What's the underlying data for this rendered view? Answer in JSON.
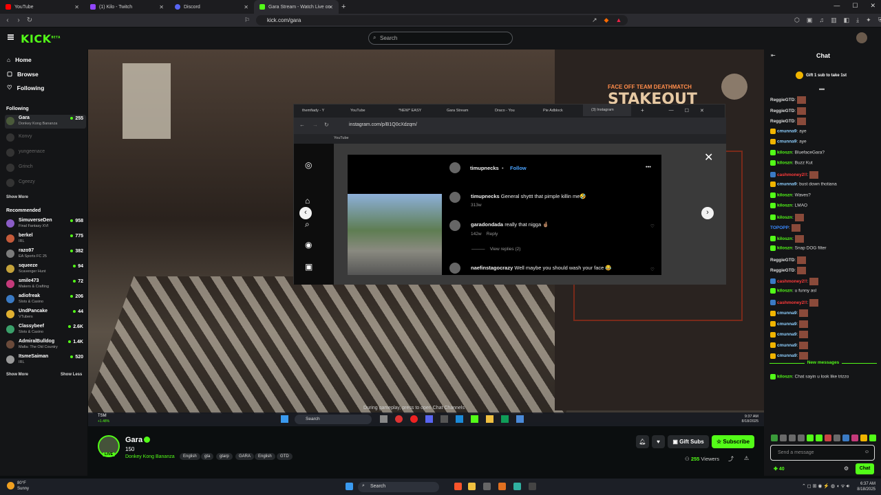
{
  "browser": {
    "tabs": [
      {
        "title": "YouTube",
        "color": "#ff0000"
      },
      {
        "title": "(1) Kilo - Twitch",
        "color": "#9146ff"
      },
      {
        "title": "Discord",
        "color": "#5865f2"
      },
      {
        "title": "Gara Stream - Watch Live on",
        "color": "#53fc18"
      }
    ],
    "url": "kick.com/gara"
  },
  "header": {
    "logo": "KICK",
    "logo_sup": "BETA",
    "search_placeholder": "Search"
  },
  "sidebar": {
    "nav": [
      {
        "label": "Home",
        "icon": "home-icon"
      },
      {
        "label": "Browse",
        "icon": "browse-icon"
      },
      {
        "label": "Following",
        "icon": "heart-icon"
      }
    ],
    "following_heading": "Following",
    "following": [
      {
        "name": "Gara",
        "game": "Donkey Kong Bananza",
        "viewers": "255",
        "live": true
      },
      {
        "name": "Konvy",
        "live": false
      },
      {
        "name": "yungeenace",
        "live": false
      },
      {
        "name": "Grinch",
        "live": false
      },
      {
        "name": "Cgeezy",
        "live": false
      }
    ],
    "show_more_1": "Show More",
    "recommended_heading": "Recommended",
    "recommended": [
      {
        "name": "SimuverseDen",
        "game": "Final Fantasy XVI",
        "viewers": "958",
        "color": "#8a5cc6"
      },
      {
        "name": "berkel",
        "game": "IRL",
        "viewers": "775",
        "color": "#c45a3a"
      },
      {
        "name": "razo97",
        "game": "EA Sports FC 25",
        "viewers": "382",
        "color": "#7b7b7b"
      },
      {
        "name": "squeeze",
        "game": "Scavenger Hunt",
        "viewers": "94",
        "color": "#c4a23a"
      },
      {
        "name": "smile473",
        "game": "Makers & Crafting",
        "viewers": "72",
        "color": "#c43a7a"
      },
      {
        "name": "adiofreak",
        "game": "Slots & Casino",
        "viewers": "206",
        "color": "#3a7ac4"
      },
      {
        "name": "UndPancake",
        "game": "VTubers",
        "viewers": "44",
        "color": "#e0b030"
      },
      {
        "name": "Classybeef",
        "game": "Slots & Casino",
        "viewers": "2.6K",
        "color": "#3aa06a"
      },
      {
        "name": "AdmiralBulldog",
        "game": "Mafia: The Old Country",
        "viewers": "1.4K",
        "color": "#6a4a3a"
      },
      {
        "name": "ItsmeSaiman",
        "game": "IRL",
        "viewers": "520",
        "color": "#999999"
      }
    ],
    "show_more_2": "Show More",
    "show_less": "Show Less"
  },
  "video": {
    "stakeout_small": "FACE OFF TEAM DEATHMATCH",
    "stakeout": "STAKEOUT",
    "caption": "During gameplay, press     to open Chat Channels",
    "inner_taskbar": {
      "search": "Search",
      "ticker": "TSM",
      "ticker_change": "+1.48%",
      "time": "9:37 AM",
      "date": "8/18/2025"
    },
    "instagram_window": {
      "tabs": [
        "themfiady - Y",
        "YouTube",
        "*NEW* EASY",
        "Gara Stream",
        "Draco - You",
        "Pie Adblock",
        "(3) Instagram"
      ],
      "url": "instagram.com/p/B1Q0cXdzqm/",
      "bookmark": "YouTube",
      "post_user": "timupnecks",
      "follow": "Follow",
      "comments": [
        {
          "user": "timupnecks",
          "text": "General shyttt that pimple killin me🤣",
          "meta": "313w"
        },
        {
          "user": "garadondada",
          "text": "really that nigga 🤞🏽",
          "meta": "142w",
          "reply": "Reply"
        },
        {
          "user": "naefinstagocrazy",
          "text": "Well maybe you should wash your face 😂"
        }
      ],
      "view_replies": "View replies (2)"
    }
  },
  "stream_info": {
    "name": "Gara",
    "followers": "150",
    "game": "Donkey Kong Bananza",
    "live_badge": "LIVE",
    "tags": [
      "English",
      "gta",
      "gtarp",
      "GARA",
      "English",
      "GTD"
    ],
    "gift_subs": "Gift Subs",
    "subscribe": "Subscribe",
    "viewers": "255",
    "viewers_label": "Viewers"
  },
  "chat": {
    "title": "Chat",
    "gift_banner": "Gift 1 sub to take 1st",
    "messages": [
      {
        "user": "ReggieGTD",
        "color": "#dddddd",
        "text": "",
        "emote": true
      },
      {
        "user": "ReggieGTD",
        "color": "#dddddd",
        "text": "",
        "emote": true
      },
      {
        "user": "ReggieGTD",
        "color": "#dddddd",
        "text": "",
        "emote": true
      },
      {
        "user": "cmunna9",
        "color": "#8fd0ff",
        "text": "aye",
        "badge": "#f0b400"
      },
      {
        "user": "cmunna9",
        "color": "#8fd0ff",
        "text": "aye",
        "badge": "#f0b400"
      },
      {
        "user": "kiloszn",
        "color": "#53fc18",
        "text": "BluefaceGara?",
        "badge": "#53fc18"
      },
      {
        "user": "kiloszn",
        "color": "#53fc18",
        "text": "Buzz Kut",
        "badge": "#53fc18"
      },
      {
        "user": "cashmoney2!!",
        "color": "#ff3b3b",
        "text": "",
        "badge": "#3a7ac4",
        "emote": true
      },
      {
        "user": "cmunna9",
        "color": "#8fd0ff",
        "text": "bust down thotiana",
        "badge": "#f0b400"
      },
      {
        "user": "kiloszn",
        "color": "#53fc18",
        "text": "Waves?",
        "badge": "#53fc18"
      },
      {
        "user": "kiloszn",
        "color": "#53fc18",
        "text": "LMAO",
        "badge": "#53fc18"
      },
      {
        "user": "kiloszn",
        "color": "#53fc18",
        "text": "",
        "badge": "#53fc18",
        "emote": true
      },
      {
        "user": "TOPOPP",
        "color": "#3a8aff",
        "text": "",
        "emote": true
      },
      {
        "user": "kiloszn",
        "color": "#53fc18",
        "text": "",
        "badge": "#53fc18",
        "emote": true
      },
      {
        "user": "kiloszn",
        "color": "#53fc18",
        "text": "Snap DOG filter",
        "badge": "#53fc18"
      },
      {
        "user": "ReggieGTD",
        "color": "#dddddd",
        "text": "",
        "emote": true
      },
      {
        "user": "ReggieGTD",
        "color": "#dddddd",
        "text": "",
        "emote": true
      },
      {
        "user": "cashmoney2!!",
        "color": "#ff3b3b",
        "text": "",
        "badge": "#3a7ac4",
        "emote": true
      },
      {
        "user": "kiloszn",
        "color": "#53fc18",
        "text": "u funny asl",
        "badge": "#53fc18"
      },
      {
        "user": "cashmoney2!!",
        "color": "#ff3b3b",
        "text": "",
        "badge": "#3a7ac4",
        "emote": true
      },
      {
        "user": "cmunna9",
        "color": "#8fd0ff",
        "text": "",
        "badge": "#f0b400",
        "emote": true
      },
      {
        "user": "cmunna9",
        "color": "#8fd0ff",
        "text": "",
        "badge": "#f0b400",
        "emote": true
      },
      {
        "user": "cmunna9",
        "color": "#8fd0ff",
        "text": "",
        "badge": "#f0b400",
        "emote": true
      },
      {
        "user": "cmunna9",
        "color": "#8fd0ff",
        "text": "",
        "badge": "#f0b400",
        "emote": true
      },
      {
        "user": "cmunna9",
        "color": "#8fd0ff",
        "text": "",
        "badge": "#f0b400",
        "emote": true
      }
    ],
    "new_messages": "New messages",
    "last_message": {
      "user": "kiloszn",
      "text": "Chat sayin u look like trizzo"
    },
    "input_placeholder": "Send a message",
    "points": "40",
    "send": "Chat"
  },
  "taskbar": {
    "weather_temp": "80°F",
    "weather_desc": "Sunny",
    "search": "Search",
    "time": "6:37 AM",
    "date": "8/18/2025"
  }
}
